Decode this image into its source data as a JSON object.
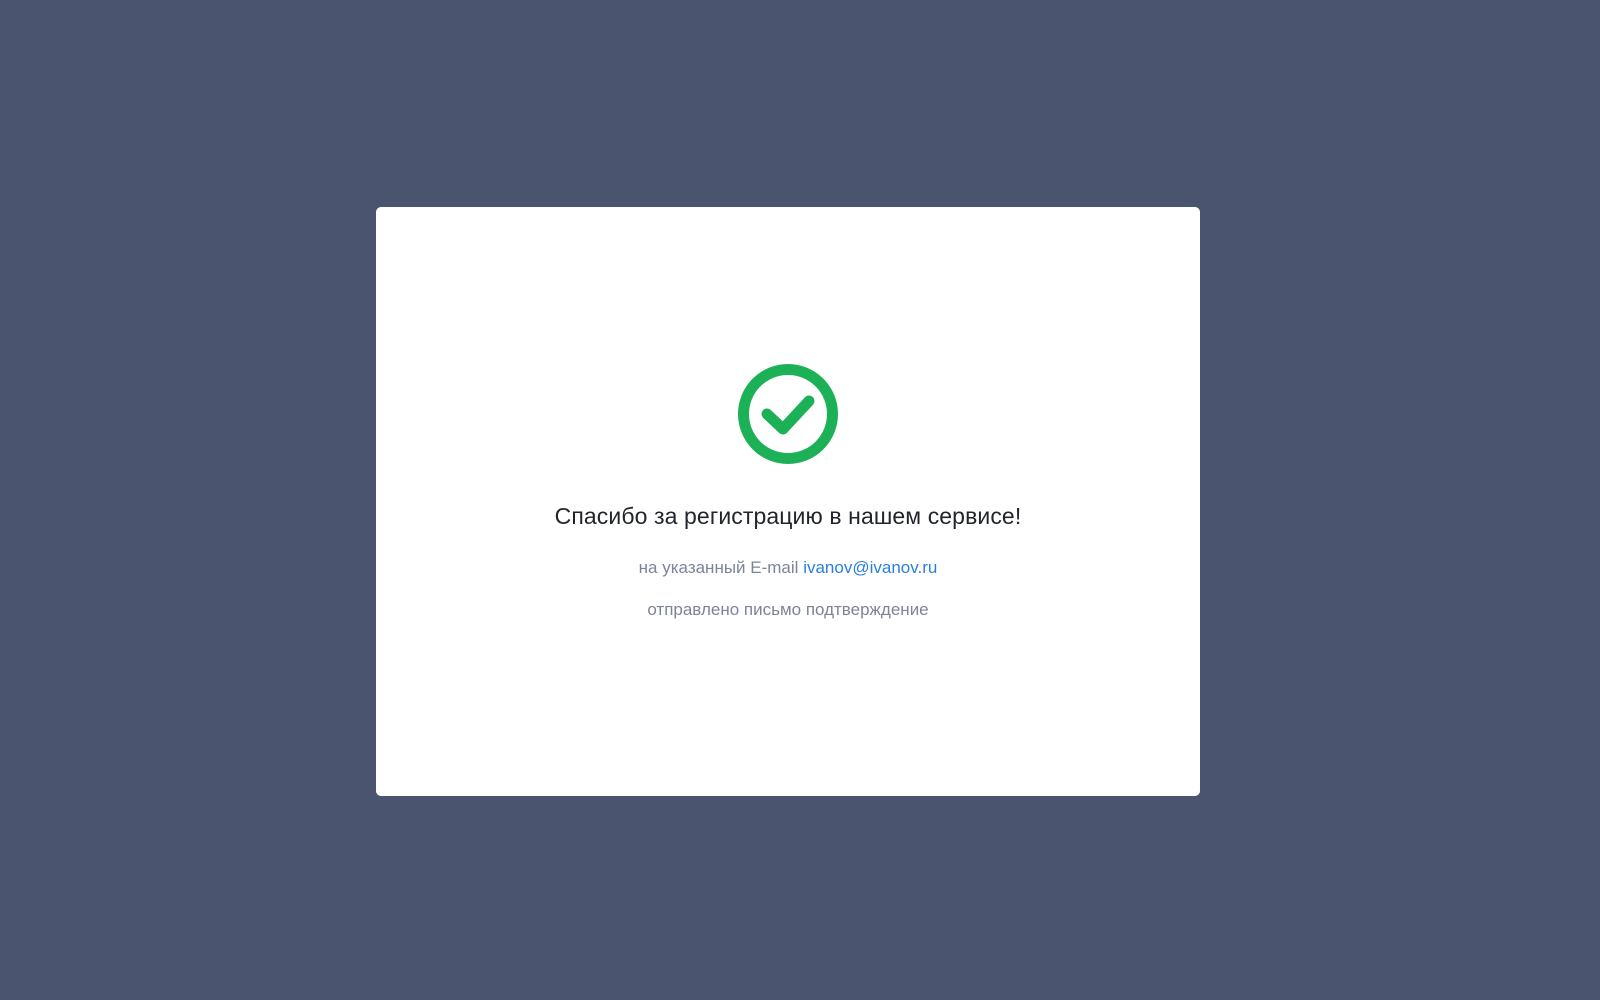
{
  "modal": {
    "icon": "check-circle-icon",
    "title": "Спасибо за регистрацию в нашем сервисе!",
    "message_prefix": "на указанный E-mail",
    "email": "ivanov@ivanov.ru",
    "message_suffix": "отправлено письмо подтверждение"
  },
  "colors": {
    "background": "#4b546f",
    "card": "#ffffff",
    "success": "#1db157",
    "link": "#2a7fe0",
    "muted_text": "#7d849a",
    "title_text": "#22252c"
  }
}
